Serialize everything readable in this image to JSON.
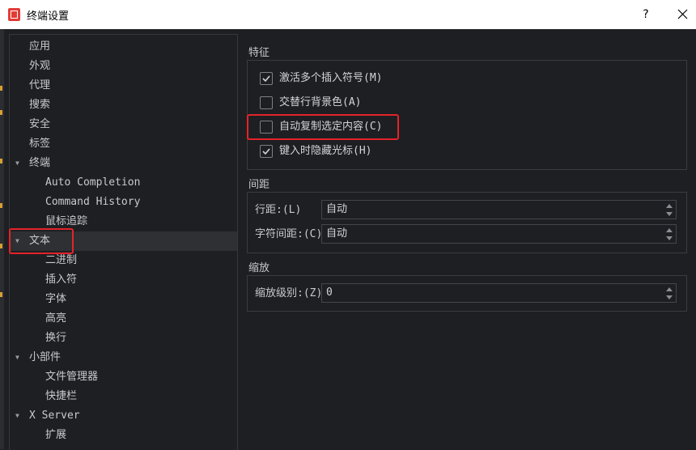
{
  "window": {
    "title": "终端设置",
    "help_label": "?"
  },
  "sidebar": {
    "items": [
      {
        "label": "应用",
        "level": 0,
        "expanded": null
      },
      {
        "label": "外观",
        "level": 0,
        "expanded": null
      },
      {
        "label": "代理",
        "level": 0,
        "expanded": null
      },
      {
        "label": "搜索",
        "level": 0,
        "expanded": null
      },
      {
        "label": "安全",
        "level": 0,
        "expanded": null
      },
      {
        "label": "标签",
        "level": 0,
        "expanded": null
      },
      {
        "label": "终端",
        "level": 0,
        "expanded": true
      },
      {
        "label": "Auto Completion",
        "level": 1,
        "expanded": null
      },
      {
        "label": "Command History",
        "level": 1,
        "expanded": null
      },
      {
        "label": "鼠标追踪",
        "level": 1,
        "expanded": null
      },
      {
        "label": "文本",
        "level": 0,
        "expanded": true,
        "selected": true
      },
      {
        "label": "二进制",
        "level": 1,
        "expanded": null
      },
      {
        "label": "插入符",
        "level": 1,
        "expanded": null
      },
      {
        "label": "字体",
        "level": 1,
        "expanded": null
      },
      {
        "label": "高亮",
        "level": 1,
        "expanded": null
      },
      {
        "label": "换行",
        "level": 1,
        "expanded": null
      },
      {
        "label": "小部件",
        "level": 0,
        "expanded": true
      },
      {
        "label": "文件管理器",
        "level": 1,
        "expanded": null
      },
      {
        "label": "快捷栏",
        "level": 1,
        "expanded": null
      },
      {
        "label": "X Server",
        "level": 0,
        "expanded": true
      },
      {
        "label": "扩展",
        "level": 1,
        "expanded": null
      }
    ]
  },
  "features": {
    "title": "特征",
    "options": [
      {
        "label": "激活多个插入符号(M)",
        "checked": true
      },
      {
        "label": "交替行背景色(A)",
        "checked": false
      },
      {
        "label": "自动复制选定内容(C)",
        "checked": false
      },
      {
        "label": "键入时隐藏光标(H)",
        "checked": true
      }
    ]
  },
  "spacing": {
    "title": "间距",
    "line_label": "行距:(L)",
    "line_value": "自动",
    "char_label": "字符间距:(C)",
    "char_value": "自动"
  },
  "zoom": {
    "title": "缩放",
    "level_label": "缩放级别:(Z)",
    "level_value": "0"
  },
  "colors": {
    "highlight": "#e4232a",
    "accent_icon": "#e23b36"
  }
}
